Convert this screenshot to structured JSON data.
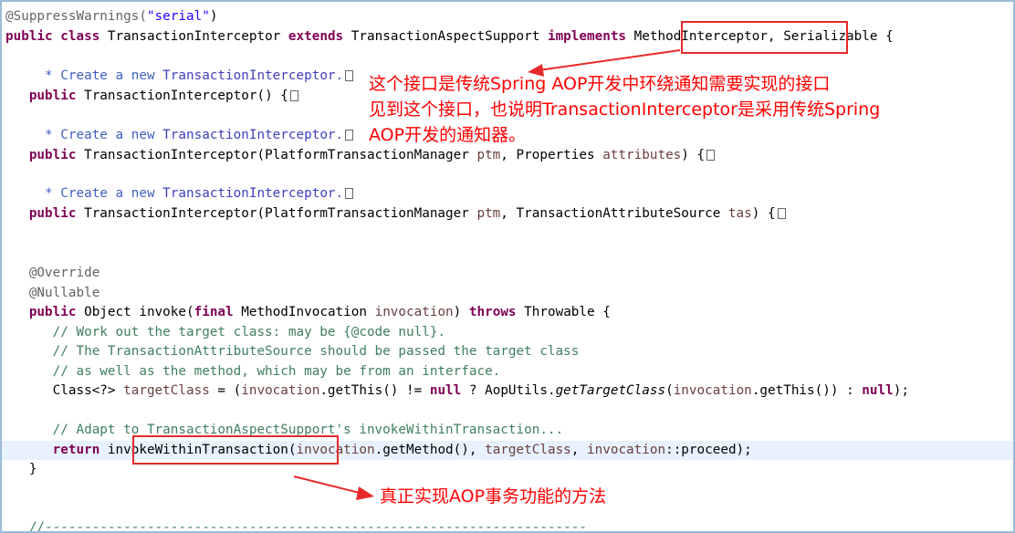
{
  "code": {
    "l1_ann": "@SuppressWarnings(",
    "l1_str": "\"serial\"",
    "l1_end": ")",
    "l2_pub": "public",
    "l2_class": "class",
    "l2_name": " TransactionInterceptor ",
    "l2_extends": "extends",
    "l2_sup": " TransactionAspectSupport ",
    "l2_impl": "implements",
    "l2_iface": "MethodInterceptor",
    "l2_rest": ", Serializable {",
    "c1a": " * Create a new ",
    "c1b": "TransactionInterceptor",
    "c1c": ".",
    "l4_pub": "public",
    "l4_rest": " TransactionInterceptor() {",
    "c2a": " * Create a new ",
    "c2b": "TransactionInterceptor",
    "c2c": ".",
    "l6_pub": "public",
    "l6_a": " TransactionInterceptor(PlatformTransactionManager ",
    "l6_p1": "ptm",
    "l6_b": ", Properties ",
    "l6_p2": "attributes",
    "l6_c": ") {",
    "c3a": " * Create a new ",
    "c3b": "TransactionInterceptor",
    "c3c": ".",
    "l8_pub": "public",
    "l8_a": " TransactionInterceptor(PlatformTransactionManager ",
    "l8_p1": "ptm",
    "l8_b": ", TransactionAttributeSource ",
    "l8_p2": "tas",
    "l8_c": ") {",
    "override": "@Override",
    "nullable": "@Nullable",
    "inv_pub": "public",
    "inv_a": " Object invoke(",
    "inv_final": "final",
    "inv_b": " MethodInvocation ",
    "inv_p": "invocation",
    "inv_c": ") ",
    "inv_throws": "throws",
    "inv_d": " Throwable {",
    "cm1": "// Work out the target class: may be {@code null}.",
    "cm2": "// The TransactionAttributeSource should be passed the target class",
    "cm3": "// as well as the method, which may be from an interface.",
    "tc_a": "Class<?> ",
    "tc_v": "targetClass",
    "tc_b": " = (",
    "tc_p": "invocation",
    "tc_c": ".getThis() != ",
    "tc_null": "null",
    "tc_d": " ? AopUtils.",
    "tc_m": "getTargetClass",
    "tc_e": "(",
    "tc_p2": "invocation",
    "tc_f": ".getThis()) : ",
    "tc_null2": "null",
    "tc_g": ");",
    "cm4": "// Adapt to TransactionAspectSupport's invokeWithinTransaction...",
    "ret_kw": "return",
    "ret_sp": " ",
    "ret_m": "invokeWithinTransaction",
    "ret_a": "(",
    "ret_p": "invocation",
    "ret_b": ".getMethod(), ",
    "ret_v": "targetClass",
    "ret_c": ", ",
    "ret_p2": "invocation",
    "ret_d": "::proceed);",
    "close": "}",
    "sep": "//---------------------------------------------------------------------"
  },
  "callouts": {
    "top_line1": "这个接口是传统Spring AOP开发中环绕通知需要实现的接口",
    "top_line2": "见到这个接口，也说明TransactionInterceptor是采用传统Spring",
    "top_line3": "AOP开发的通知器。",
    "bottom": "真正实现AOP事务功能的方法"
  },
  "colors": {
    "keyword": "#7f0055",
    "annotation": "#646464",
    "string": "#2a00ff",
    "javadoc": "#3f5fbf",
    "line_comment": "#3f7f5f",
    "callout_red": "#ff0000",
    "highlight_line": "#e8f2fe"
  }
}
